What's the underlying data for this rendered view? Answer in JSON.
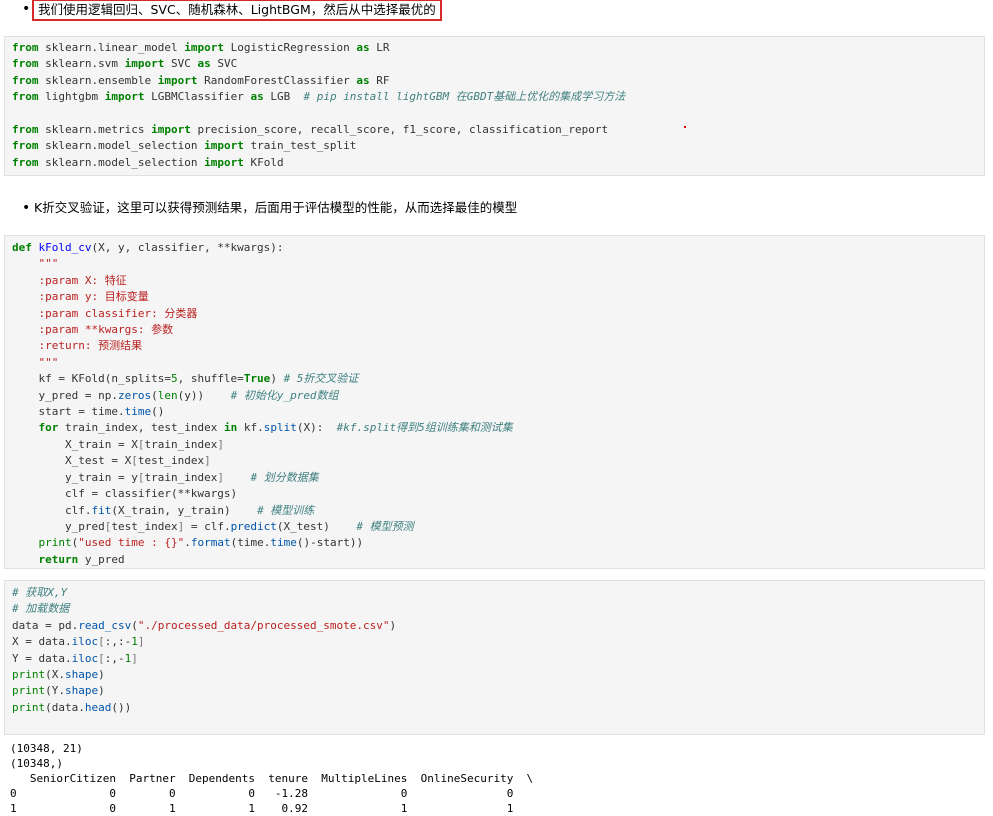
{
  "bullet1": "我们使用逻辑回归、SVC、随机森林、LightBGM，然后从中选择最优的",
  "bullet2": "K折交叉验证，这里可以获得预测结果，后面用于评估模型的性能，从而选择最佳的模型",
  "cell1": {
    "lines": [
      "from sklearn.linear_model import LogisticRegression as LR",
      "from sklearn.svm import SVC as SVC",
      "from sklearn.ensemble import RandomForestClassifier as RF",
      "from lightgbm import LGBMClassifier as LGB  # pip install lightGBM 在GBDT基础上优化的集成学习方法",
      "",
      "from sklearn.metrics import precision_score, recall_score, f1_score, classification_report",
      "from sklearn.model_selection import train_test_split",
      "from sklearn.model_selection import KFold"
    ]
  },
  "cell2": {
    "lines": [
      "def kFold_cv(X, y, classifier, **kwargs):",
      "    \"\"\"",
      "    :param X: 特征",
      "    :param y: 目标变量",
      "    :param classifier: 分类器",
      "    :param **kwargs: 参数",
      "    :return: 预测结果",
      "    \"\"\"",
      "    kf = KFold(n_splits=5, shuffle=True) # 5折交叉验证",
      "    y_pred = np.zeros(len(y))    # 初始化y_pred数组",
      "    start = time.time()",
      "    for train_index, test_index in kf.split(X):  #kf.split得到5组训练集和测试集",
      "        X_train = X[train_index]",
      "        X_test = X[test_index]",
      "        y_train = y[train_index]    # 划分数据集",
      "        clf = classifier(**kwargs)",
      "        clf.fit(X_train, y_train)    # 模型训练",
      "        y_pred[test_index] = clf.predict(X_test)    # 模型预测",
      "    print(\"used time : {}\".format(time.time()-start))",
      "    return y_pred"
    ]
  },
  "cell3": {
    "lines": [
      "# 获取X,Y",
      "# 加载数据",
      "data = pd.read_csv(\"./processed_data/processed_smote.csv\")",
      "X = data.iloc[:,:-1]",
      "Y = data.iloc[:,-1]",
      "print(X.shape)",
      "print(Y.shape)",
      "print(data.head())"
    ]
  },
  "output": {
    "lines": [
      "(10348, 21)",
      "(10348,)",
      "   SeniorCitizen  Partner  Dependents  tenure  MultipleLines  OnlineSecurity  \\",
      "0              0        0           0   -1.28              0               0",
      "1              0        1           1    0.92              1               1"
    ]
  }
}
